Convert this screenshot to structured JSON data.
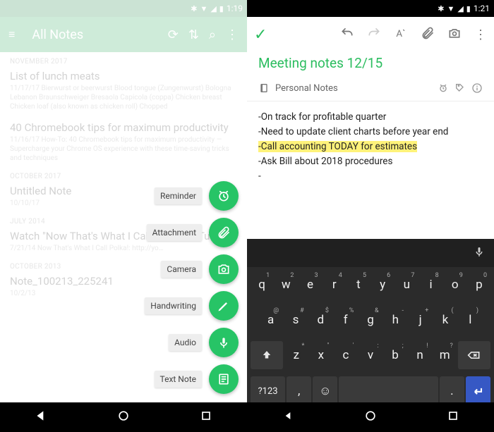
{
  "left": {
    "status_time": "1:19",
    "header_title": "All Notes",
    "sections": [
      {
        "date": "NOVEMBER 2017",
        "notes": [
          {
            "title": "List of lunch meats",
            "sub": "11/17/17 Bierwurst or beerwurst Blood tongue (Zungenwurst) Bologna Lebanon Braunschweiger Bresaola Capicola (coppa) Chicken breast Chicken loaf (also known as chicken roll) Chopped"
          },
          {
            "title": "40 Chromebook tips for maximum productivity",
            "sub": "11/16/17 How-To: 40 Chromebook tips for maximum productivity — Supercharge your Chrome OS experience with these time-saving tricks and techniques"
          }
        ]
      },
      {
        "date": "OCTOBER 2017",
        "notes": [
          {
            "title": "Untitled Note",
            "sub": "10/10/17"
          }
        ]
      },
      {
        "date": "JULY 2014",
        "notes": [
          {
            "title": "Watch \"Now That's What I Call …\" on YouTube",
            "sub": "7/21/14 Now That's What I Call Polka!: http://yo…"
          }
        ]
      },
      {
        "date": "OCTOBER 2013",
        "notes": [
          {
            "title": "Note_100213_225241",
            "sub": "10/2/13"
          }
        ]
      }
    ],
    "fab": [
      {
        "label": "Reminder",
        "icon": "alarm"
      },
      {
        "label": "Attachment",
        "icon": "clip"
      },
      {
        "label": "Camera",
        "icon": "camera"
      },
      {
        "label": "Handwriting",
        "icon": "pen"
      },
      {
        "label": "Audio",
        "icon": "mic"
      },
      {
        "label": "Text Note",
        "icon": "note"
      }
    ]
  },
  "right": {
    "status_time": "1:21",
    "note_title": "Meeting notes 12/15",
    "notebook": "Personal Notes",
    "body": [
      {
        "t": "-On track for profitable quarter"
      },
      {
        "t": "-Need to update client charts before year end"
      },
      {
        "t": "-Call accounting TODAY for estimates",
        "hl": true
      },
      {
        "t": "-Ask Bill about 2018 procedures"
      },
      {
        "t": "-"
      }
    ],
    "keyboard": {
      "row1": [
        "q",
        "w",
        "e",
        "r",
        "t",
        "y",
        "u",
        "i",
        "o",
        "p"
      ],
      "row1sup": [
        "1",
        "2",
        "3",
        "4",
        "5",
        "6",
        "7",
        "8",
        "9",
        "0"
      ],
      "row2": [
        "a",
        "s",
        "d",
        "f",
        "g",
        "h",
        "j",
        "k",
        "l"
      ],
      "row3": [
        "z",
        "x",
        "c",
        "v",
        "b",
        "n",
        "m"
      ],
      "sym": "?123",
      "comma": ",",
      "dot": "."
    }
  }
}
